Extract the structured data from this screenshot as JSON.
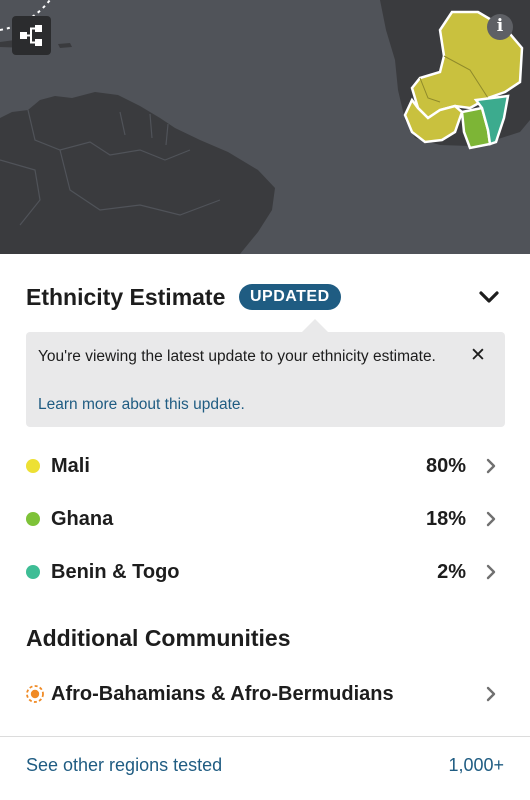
{
  "map": {
    "highlight_colors": {
      "mali": "#c9c13e",
      "ghana": "#7db536",
      "benin_togo": "#3cab8e"
    }
  },
  "toolbar": {
    "tree_icon": "family-tree-icon",
    "info_icon": "info-icon",
    "info_glyph": "i"
  },
  "ethnicity": {
    "title": "Ethnicity Estimate",
    "badge": "UPDATED",
    "collapse_icon": "chevron-down-icon",
    "notice": {
      "text": "You're viewing the latest update to your ethnicity estimate.",
      "link": "Learn more about this update.",
      "close_glyph": "✕"
    },
    "regions": [
      {
        "name": "Mali",
        "percent": "80%",
        "color": "#ede034"
      },
      {
        "name": "Ghana",
        "percent": "18%",
        "color": "#7ec238"
      },
      {
        "name": "Benin & Togo",
        "percent": "2%",
        "color": "#3ebd95"
      }
    ]
  },
  "additional": {
    "title": "Additional Communities",
    "items": [
      {
        "name": "Afro-Bahamians & Afro-Bermudians",
        "icon": "community-dot-icon",
        "color": "#f08a24"
      }
    ]
  },
  "footer": {
    "link": "See other regions tested",
    "count": "1,000+"
  }
}
